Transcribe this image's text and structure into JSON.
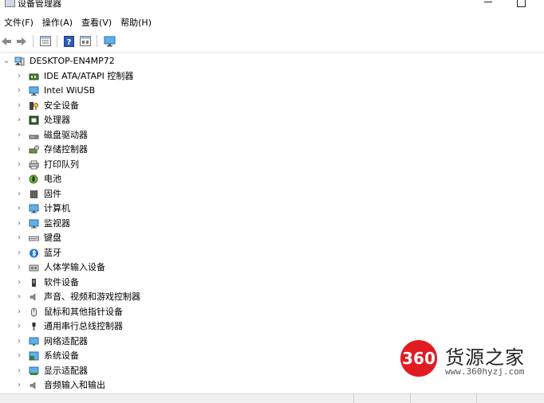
{
  "window": {
    "title": "设备管理器"
  },
  "menu": [
    {
      "label": "文件(F)"
    },
    {
      "label": "操作(A)"
    },
    {
      "label": "查看(V)"
    },
    {
      "label": "帮助(H)"
    }
  ],
  "toolbar_icons": [
    "back-arrow-icon",
    "forward-arrow-icon",
    "properties-icon",
    "help-icon",
    "view-icon",
    "monitor-icon"
  ],
  "tree": {
    "root": "DESKTOP-EN4MP72",
    "items": [
      {
        "label": "IDE ATA/ATAPI 控制器",
        "icon": "ide-controller-icon"
      },
      {
        "label": "Intel WiUSB",
        "icon": "network-monitor-icon"
      },
      {
        "label": "安全设备",
        "icon": "security-device-icon"
      },
      {
        "label": "处理器",
        "icon": "processor-icon"
      },
      {
        "label": "磁盘驱动器",
        "icon": "disk-drive-icon"
      },
      {
        "label": "存储控制器",
        "icon": "storage-controller-icon"
      },
      {
        "label": "打印队列",
        "icon": "printer-icon"
      },
      {
        "label": "电池",
        "icon": "battery-icon"
      },
      {
        "label": "固件",
        "icon": "firmware-icon"
      },
      {
        "label": "计算机",
        "icon": "computer-icon"
      },
      {
        "label": "监视器",
        "icon": "monitor-icon"
      },
      {
        "label": "键盘",
        "icon": "keyboard-icon"
      },
      {
        "label": "蓝牙",
        "icon": "bluetooth-icon"
      },
      {
        "label": "人体学输入设备",
        "icon": "hid-icon"
      },
      {
        "label": "软件设备",
        "icon": "software-device-icon"
      },
      {
        "label": "声音、视频和游戏控制器",
        "icon": "speaker-icon"
      },
      {
        "label": "鼠标和其他指针设备",
        "icon": "mouse-icon"
      },
      {
        "label": "通用串行总线控制器",
        "icon": "usb-icon"
      },
      {
        "label": "网络适配器",
        "icon": "network-adapter-icon"
      },
      {
        "label": "系统设备",
        "icon": "system-device-icon"
      },
      {
        "label": "显示适配器",
        "icon": "display-adapter-icon"
      },
      {
        "label": "音频输入和输出",
        "icon": "audio-io-icon"
      }
    ]
  },
  "watermark": {
    "badge": "360",
    "text": "货源之家",
    "url": "www.360hyzj.com"
  }
}
